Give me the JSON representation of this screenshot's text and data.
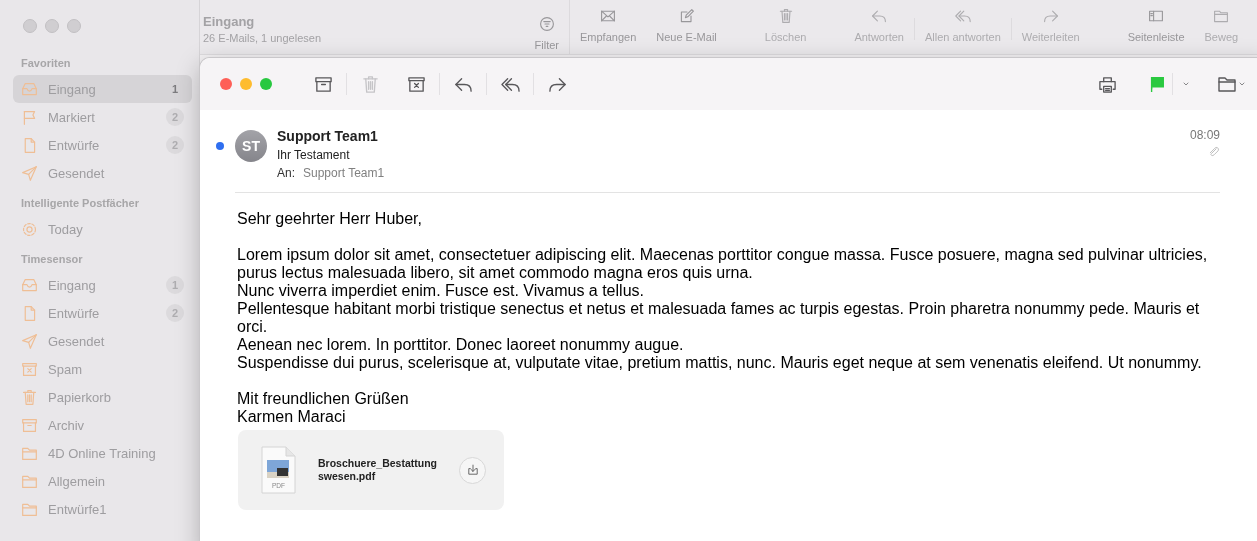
{
  "main_window": {
    "sidebar": {
      "sections": [
        {
          "heading": "Favoriten",
          "items": [
            {
              "kind": "inbox",
              "label": "Eingang",
              "count": "1",
              "selected": true
            },
            {
              "kind": "flag",
              "label": "Markiert",
              "count": "2",
              "selected": false
            },
            {
              "kind": "doc",
              "label": "Entwürfe",
              "count": "2",
              "selected": false
            },
            {
              "kind": "send",
              "label": "Gesendet",
              "selected": false
            }
          ]
        },
        {
          "heading": "Intelligente Postfächer",
          "items": [
            {
              "kind": "gear",
              "label": "Today",
              "selected": false
            }
          ]
        },
        {
          "heading": "Timesensor",
          "items": [
            {
              "kind": "inbox",
              "label": "Eingang",
              "count": "1",
              "selected": false
            },
            {
              "kind": "doc",
              "label": "Entwürfe",
              "count": "2",
              "selected": false
            },
            {
              "kind": "send",
              "label": "Gesendet",
              "selected": false
            },
            {
              "kind": "junk",
              "label": "Spam",
              "selected": false
            },
            {
              "kind": "trash",
              "label": "Papierkorb",
              "selected": false
            },
            {
              "kind": "archive",
              "label": "Archiv",
              "selected": false
            },
            {
              "kind": "folder",
              "label": "4D Online Training",
              "selected": false
            },
            {
              "kind": "folder",
              "label": "Allgemein",
              "selected": false
            },
            {
              "kind": "folder",
              "label": "Entwürfe1",
              "selected": false
            }
          ]
        }
      ]
    },
    "list_header": {
      "title": "Eingang",
      "subtitle": "26 E-Mails, 1 ungelesen",
      "filter": {
        "kind": "filter",
        "label": "Filter",
        "disabled": false
      }
    },
    "toolbar": [
      {
        "kind": "envelope",
        "label": "Empfangen",
        "disabled": false
      },
      {
        "kind": "compose",
        "label": "Neue E-Mail",
        "disabled": false
      },
      {
        "kind": "trash",
        "label": "Löschen",
        "disabled": true
      },
      {
        "kind": "reply",
        "label": "Antworten",
        "disabled": true
      },
      {
        "kind": "replyall",
        "label": "Allen antworten",
        "disabled": true
      },
      {
        "kind": "forward",
        "label": "Weiterleiten",
        "disabled": true
      },
      {
        "kind": "sidebar",
        "label": "Seitenleiste",
        "disabled": false
      },
      {
        "kind": "folder",
        "label": "Beweg",
        "disabled": true
      }
    ]
  },
  "message_window": {
    "toolbar_left": [
      {
        "kind": "archive",
        "disabled": false
      },
      {
        "kind": "trash",
        "disabled": true
      },
      {
        "kind": "junk",
        "disabled": false
      },
      {
        "kind": "reply",
        "disabled": false
      },
      {
        "kind": "replyall",
        "disabled": false
      },
      {
        "kind": "forward",
        "disabled": false
      }
    ],
    "flagged": true,
    "header": {
      "unread": true,
      "avatar": "ST",
      "sender": "Support Team1",
      "subject": "Ihr Testament",
      "to_label": "An:",
      "to": "Support Team1",
      "time": "08:09",
      "has_attachment": true
    },
    "body": [
      [
        "Sehr geehrter Herr Huber,"
      ],
      [
        "Lorem ipsum dolor sit amet, consectetuer adipiscing elit. Maecenas porttitor congue massa. Fusce posuere, magna sed pulvinar ultricies, purus lectus malesuada libero, sit amet commodo magna eros quis urna.",
        "Nunc viverra imperdiet enim. Fusce est. Vivamus a tellus.",
        "Pellentesque habitant morbi tristique senectus et netus et malesuada fames ac turpis egestas. Proin pharetra nonummy pede. Mauris et orci.",
        "Aenean nec lorem. In porttitor. Donec laoreet nonummy augue.",
        "Suspendisse dui purus, scelerisque at, vulputate vitae, pretium mattis, nunc. Mauris eget neque at sem venenatis eleifend. Ut nonummy."
      ],
      [
        "Mit freundlichen Grüßen",
        "Karmen Maraci"
      ]
    ],
    "attachment": {
      "type_label": "PDF",
      "name_lines": [
        "Broschuere_Bestattung",
        "swesen.pdf"
      ]
    }
  }
}
